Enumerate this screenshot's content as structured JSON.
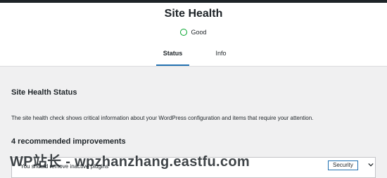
{
  "header": {
    "title": "Site Health",
    "rating_label": "Good",
    "tabs": [
      {
        "label": "Status"
      },
      {
        "label": "Info"
      }
    ]
  },
  "main": {
    "section_title": "Site Health Status",
    "description": "The site health check shows critical information about your WordPress configuration and items that require your attention.",
    "improvements_count": "4 recommended improvements",
    "issues": [
      {
        "label": "You should remove inactive plugins",
        "badge": "Security"
      }
    ]
  },
  "watermark": "WP站长 - wpzhanzhang.eastfu.com",
  "colors": {
    "accent": "#2271b1",
    "good": "#00a32a",
    "background": "#f0f0f1"
  }
}
